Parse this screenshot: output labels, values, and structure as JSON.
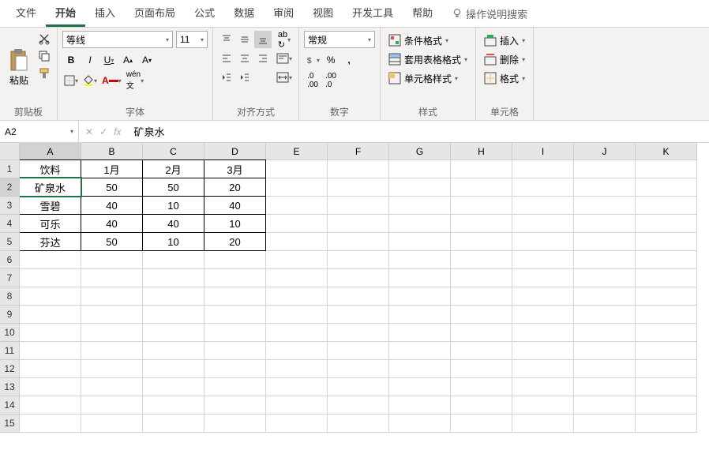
{
  "tabs": {
    "file": "文件",
    "home": "开始",
    "insert": "插入",
    "layout": "页面布局",
    "formulas": "公式",
    "data": "数据",
    "review": "审阅",
    "view": "视图",
    "dev": "开发工具",
    "help": "帮助",
    "search": "操作说明搜索"
  },
  "ribbon": {
    "clipboard": {
      "label": "剪贴板",
      "paste": "粘贴"
    },
    "font": {
      "label": "字体",
      "name": "等线",
      "size": "11"
    },
    "align": {
      "label": "对齐方式",
      "wrap": "ab"
    },
    "number": {
      "label": "数字",
      "format": "常规"
    },
    "styles": {
      "label": "样式",
      "cond": "条件格式",
      "table": "套用表格格式",
      "cell": "单元格样式"
    },
    "cells": {
      "label": "单元格",
      "insert": "插入",
      "delete": "删除",
      "format": "格式"
    }
  },
  "formula_bar": {
    "cell_ref": "A2",
    "value": "矿泉水",
    "fx": "fx"
  },
  "grid": {
    "cols": [
      "A",
      "B",
      "C",
      "D",
      "E",
      "F",
      "G",
      "H",
      "I",
      "J",
      "K"
    ],
    "rows": 15,
    "active": {
      "row": 2,
      "col": 0
    },
    "data": [
      [
        "饮料",
        "1月",
        "2月",
        "3月"
      ],
      [
        "矿泉水",
        "50",
        "50",
        "20"
      ],
      [
        "雪碧",
        "40",
        "10",
        "40"
      ],
      [
        "可乐",
        "40",
        "40",
        "10"
      ],
      [
        "芬达",
        "50",
        "10",
        "20"
      ]
    ]
  }
}
